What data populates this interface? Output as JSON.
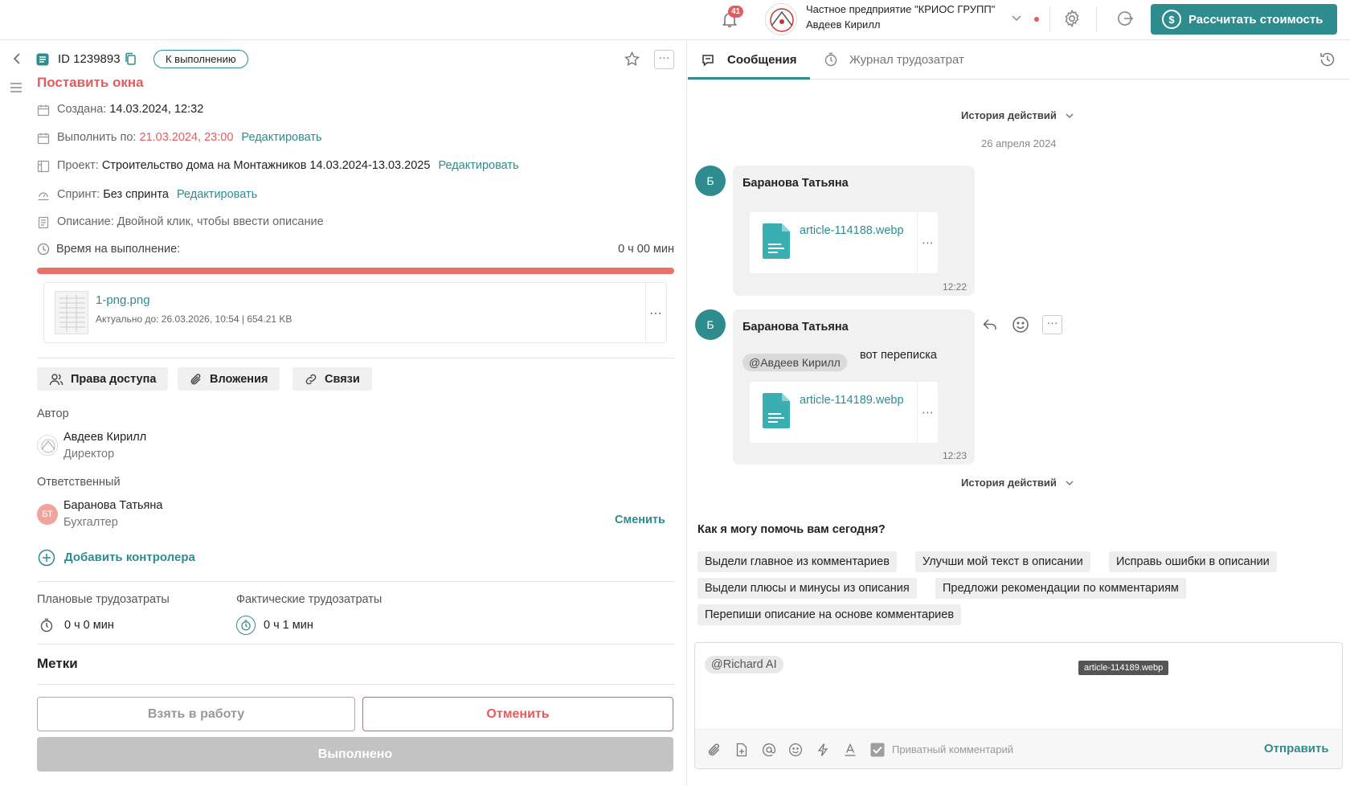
{
  "topbar": {
    "notifications_count": "41",
    "company_name": "Частное предприятие \"КРИОС ГРУПП\"",
    "user_name": "Авдеев Кирилл",
    "calc_button": "Рассчитать стоимость",
    "calc_icon": "$"
  },
  "task": {
    "id_label": "ID 1239893",
    "status": "К выполнению",
    "title": "Поставить окна",
    "created_label": "Создана:",
    "created_value": "14.03.2024, 12:32",
    "due_label": "Выполнить по:",
    "due_value": "21.03.2024, 23:00",
    "edit_label": "Редактировать",
    "project_label": "Проект:",
    "project_value": "Строительство дома на Монтажников 14.03.2024-13.03.2025",
    "sprint_label": "Спринт:",
    "sprint_value": "Без спринта",
    "description": "Описание: Двойной клик, чтобы ввести описание",
    "time_label": "Время на выполнение:",
    "time_value": "0 ч 00 мин",
    "progress_percent": 100,
    "file": {
      "name": "1-png.png",
      "meta": "Актуально до: 26.03.2026, 10:54 | 654.21 KB"
    },
    "buttons": {
      "access": "Права доступа",
      "attachments": "Вложения",
      "links": "Связи"
    },
    "author_label": "Автор",
    "author_name": "Авдеев Кирилл",
    "author_role": "Директор",
    "responsible_label": "Ответственный",
    "responsible_initials": "БТ",
    "responsible_name": "Баранова Татьяна",
    "responsible_role": "Бухгалтер",
    "change_label": "Сменить",
    "add_controller": "Добавить контролера",
    "planned_label": "Плановые трудозатраты",
    "planned_value": "0 ч 0 мин",
    "actual_label": "Фактические трудозатраты",
    "actual_value": "0 ч 1 мин",
    "tags_label": "Метки",
    "take_button": "Взять в работу",
    "cancel_button": "Отменить",
    "done_button": "Выполнено"
  },
  "chat": {
    "tab_messages": "Сообщения",
    "tab_journal": "Журнал трудозатрат",
    "history_label": "История действий",
    "date_label": "26 апреля 2024",
    "messages": [
      {
        "avatar": "Б",
        "author": "Баранова Татьяна",
        "attachment": "article-114188.webp",
        "time": "12:22"
      },
      {
        "avatar": "Б",
        "author": "Баранова Татьяна",
        "mention": "@Авдеев Кирилл",
        "text": "вот переписка",
        "attachment": "article-114189.webp",
        "time": "12:23"
      }
    ],
    "ai_prompt": "Как я могу помочь вам сегодня?",
    "chips": [
      "Выдели главное из комментариев",
      "Улучши мой текст в описании",
      "Исправь ошибки в описании",
      "Выдели плюсы и минусы из описания",
      "Предложи рекомендации по комментариям",
      "Перепиши описание на основе комментариев"
    ],
    "composer_value": "@Richard AI",
    "tooltip": "article-114189.webp",
    "private_label": "Приватный комментарий",
    "send_label": "Отправить"
  },
  "colors": {
    "accent": "#2e8c8f",
    "danger": "#e55b5b",
    "progress": "#e8726a"
  }
}
